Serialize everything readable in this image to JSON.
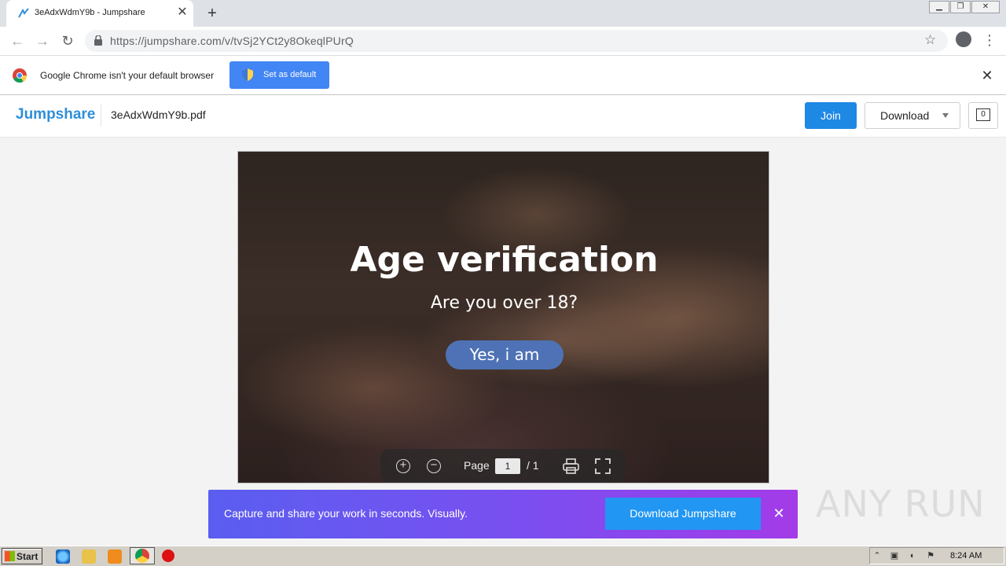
{
  "browser": {
    "tab_title": "3eAdxWdmY9b - Jumpshare",
    "url": "https://jumpshare.com/v/tvSj2YCt2y8OkeqlPUrQ"
  },
  "infobar": {
    "message": "Google Chrome isn't your default browser",
    "set_default_label": "Set as default"
  },
  "jumpshare": {
    "logo": "Jumpshare",
    "filename": "3eAdxWdmY9b.pdf",
    "join_label": "Join",
    "download_label": "Download",
    "comment_count": "0"
  },
  "document": {
    "title": "Age verification",
    "question": "Are you over 18?",
    "button_label": "Yes, i am"
  },
  "pdf_controls": {
    "page_label": "Page",
    "current_page": "1",
    "total": "/ 1"
  },
  "banner": {
    "text": "Capture and share your work in seconds. Visually.",
    "button_label": "Download Jumpshare"
  },
  "watermark": "ANY RUN",
  "taskbar": {
    "start_label": "Start",
    "clock": "8:24 AM"
  },
  "colors": {
    "accent": "#1e88e5",
    "jumpshare_blue": "#2f8fd8",
    "chrome_blue": "#4285f4",
    "age_button": "#4e72b5"
  }
}
